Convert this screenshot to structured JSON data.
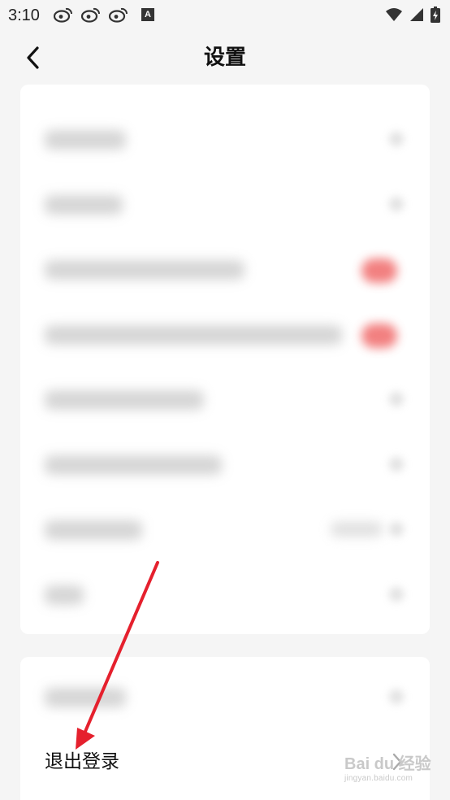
{
  "status_bar": {
    "time": "3:10",
    "badge_letter": "A",
    "icons": [
      "weibo-icon",
      "weibo-icon",
      "weibo-icon",
      "a-badge-icon",
      "wifi-icon",
      "signal-icon",
      "battery-charging-icon"
    ]
  },
  "header": {
    "title": "设置",
    "back_icon": "chevron-left-icon"
  },
  "settings_card": {
    "rows": [
      {
        "kind": "chevron"
      },
      {
        "kind": "chevron"
      },
      {
        "kind": "toggle"
      },
      {
        "kind": "toggle"
      },
      {
        "kind": "chevron"
      },
      {
        "kind": "chevron"
      },
      {
        "kind": "value-chevron"
      },
      {
        "kind": "chevron"
      }
    ]
  },
  "bottom_card": {
    "logout_label": "退出登录"
  },
  "watermark": {
    "main": "Bai du 经验",
    "sub": "jingyan.baidu.com"
  },
  "colors": {
    "background": "#f5f5f5",
    "card": "#ffffff",
    "toggle_on": "#f06a6a",
    "arrow": "#e5202d"
  }
}
